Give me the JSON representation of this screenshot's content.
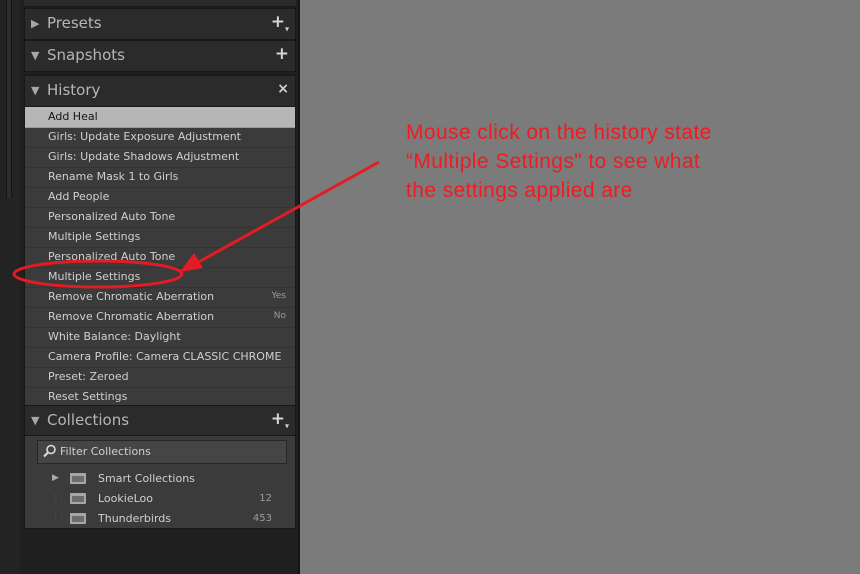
{
  "panels": {
    "presets": {
      "title": "Presets",
      "action": "+"
    },
    "snapshots": {
      "title": "Snapshots",
      "action": "+"
    },
    "history": {
      "title": "History",
      "action": "×"
    },
    "collections": {
      "title": "Collections",
      "action": "+"
    }
  },
  "history": {
    "items": [
      {
        "label": "Add Heal",
        "value": "",
        "selected": true
      },
      {
        "label": "Girls: Update Exposure Adjustment",
        "value": ""
      },
      {
        "label": "Girls: Update Shadows Adjustment",
        "value": ""
      },
      {
        "label": "Rename Mask 1 to Girls",
        "value": ""
      },
      {
        "label": "Add People",
        "value": ""
      },
      {
        "label": "Personalized Auto Tone",
        "value": ""
      },
      {
        "label": "Multiple Settings",
        "value": ""
      },
      {
        "label": "Personalized Auto Tone",
        "value": ""
      },
      {
        "label": "Multiple Settings",
        "value": ""
      },
      {
        "label": "Remove Chromatic Aberration",
        "value": "Yes"
      },
      {
        "label": "Remove Chromatic Aberration",
        "value": "No"
      },
      {
        "label": "White Balance: Daylight",
        "value": ""
      },
      {
        "label": "Camera Profile: Camera CLASSIC CHROME",
        "value": ""
      },
      {
        "label": "Preset: Zeroed",
        "value": ""
      },
      {
        "label": "Reset Settings",
        "value": ""
      }
    ]
  },
  "collections": {
    "filter_placeholder": "Filter Collections",
    "items": [
      {
        "name": "Smart Collections",
        "count": "",
        "expandable": true
      },
      {
        "name": "LookieLoo",
        "count": "12"
      },
      {
        "name": "Thunderbirds",
        "count": "453"
      }
    ]
  },
  "annotation": {
    "lines": [
      "Mouse click on the history state",
      "“Multiple Settings\" to see what",
      "the settings applied are"
    ],
    "color": "#ee1c22"
  },
  "icons": [
    "disclosure-triangle-icon",
    "plus-icon",
    "close-icon",
    "search-icon",
    "folder-icon",
    "smart-collection-icon"
  ]
}
